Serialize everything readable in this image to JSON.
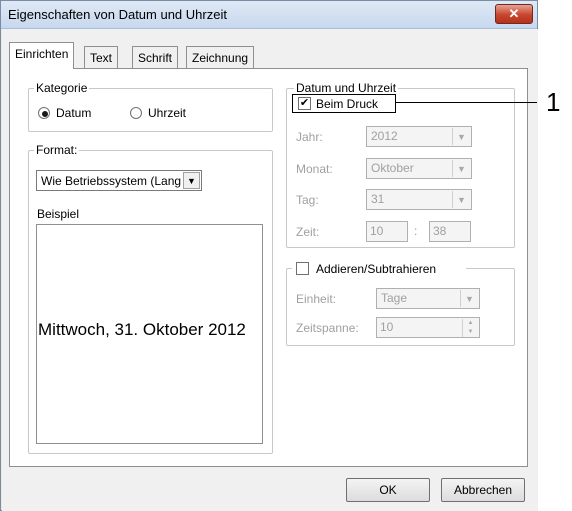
{
  "window": {
    "title": "Eigenschaften von Datum und Uhrzeit",
    "close_symbol": "✕"
  },
  "tabs": [
    {
      "label": "Einrichten",
      "active": true
    },
    {
      "label": "Text",
      "active": false
    },
    {
      "label": "Schrift",
      "active": false
    },
    {
      "label": "Zeichnung",
      "active": false
    }
  ],
  "kategorie": {
    "legend": "Kategorie",
    "option_datum": "Datum",
    "option_uhrzeit": "Uhrzeit",
    "selected": "Datum"
  },
  "format": {
    "legend": "Format:",
    "select_value": "Wie Betriebssystem (Lang",
    "beispiel_label": "Beispiel",
    "preview_text": "Mittwoch, 31. Oktober 2012"
  },
  "datum_uhrzeit": {
    "legend": "Datum und Uhrzeit",
    "beim_druck_label": "Beim Druck",
    "beim_druck_checked": true,
    "jahr_label": "Jahr:",
    "jahr_value": "2012",
    "monat_label": "Monat:",
    "monat_value": "Oktober",
    "tag_label": "Tag:",
    "tag_value": "31",
    "zeit_label": "Zeit:",
    "zeit_hour": "10",
    "zeit_sep": ":",
    "zeit_minute": "38"
  },
  "addieren": {
    "checkbox_label": "Addieren/Subtrahieren",
    "checked": false,
    "einheit_label": "Einheit:",
    "einheit_value": "Tage",
    "zeitspanne_label": "Zeitspanne:",
    "zeitspanne_value": "10"
  },
  "buttons": {
    "ok": "OK",
    "cancel": "Abbrechen"
  },
  "callout": {
    "number": "1"
  }
}
